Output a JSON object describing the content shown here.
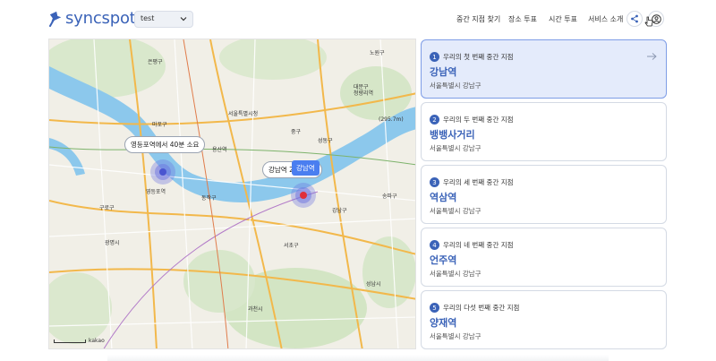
{
  "app": {
    "logo_text": "syncspot",
    "logo_icon": "pin-icon"
  },
  "header": {
    "group_select_value": "test",
    "nav": [
      "중간 지점 찾기",
      "장소 투표",
      "시간 투표",
      "서비스 소개"
    ],
    "icons": [
      "share-icon",
      "user-icon"
    ]
  },
  "map": {
    "bubble_1": "영등포역에서 40분 소요",
    "bubble_2": "강남역 2   분 소요",
    "hover_tag": "강남역",
    "scale_text": "kakao",
    "labels": [
      "서울특별시청",
      "청량리역",
      "용산역",
      "영등포역",
      "동작구",
      "강남구",
      "송파구",
      "광명시",
      "구로구",
      "과천시",
      "중구",
      "성동구",
      "서초구",
      "마포구",
      "은평구",
      "노원구",
      "대문구",
      "(295.7m)",
      "성남시"
    ]
  },
  "cards": [
    {
      "num": "1",
      "subtitle": "우리의 첫 번째 중간 지점",
      "title": "강남역",
      "address": "서울특별시 강남구",
      "active": true
    },
    {
      "num": "2",
      "subtitle": "우리의 두 번째 중간 지점",
      "title": "뱅뱅사거리",
      "address": "서울특별시 강남구",
      "active": false
    },
    {
      "num": "3",
      "subtitle": "우리의 세 번째 중간 지점",
      "title": "역삼역",
      "address": "서울특별시 강남구",
      "active": false
    },
    {
      "num": "4",
      "subtitle": "우리의 네 번째 중간 지점",
      "title": "언주역",
      "address": "서울특별시 강남구",
      "active": false
    },
    {
      "num": "5",
      "subtitle": "우리의 다섯 번째 중간 지점",
      "title": "양재역",
      "address": "서울특별시 강남구",
      "active": false
    }
  ],
  "colors": {
    "brand": "#3b63b8",
    "active_card_bg": "#e4ebfb",
    "river": "#8cc8ec"
  }
}
